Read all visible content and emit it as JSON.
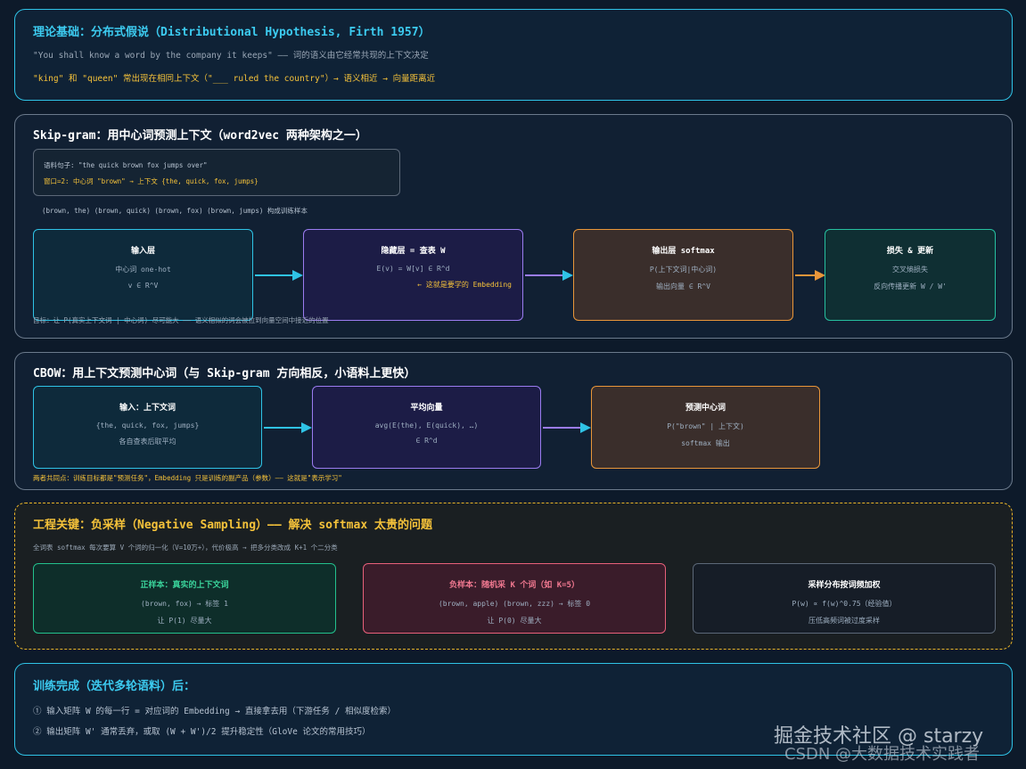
{
  "theory": {
    "title": "理论基础：分布式假说（Distributional Hypothesis, Firth 1957）",
    "quote": "\"You shall know a word by the company it keeps\" —— 词的语义由它经常共现的上下文决定",
    "example": "\"king\" 和 \"queen\" 常出现在相同上下文（\"___ ruled the country\"）→ 语义相近 → 向量距离近"
  },
  "skipgram": {
    "title": "Skip-gram：用中心词预测上下文（word2vec 两种架构之一）",
    "example_sentence": "语料句子: \"the quick brown fox jumps over\"",
    "example_window": "窗口=2: 中心词 \"brown\" → 上下文 {the, quick, fox, jumps}",
    "pairs": "(brown, the) (brown, quick) (brown, fox) (brown, jumps) 构成训练样本",
    "boxes": [
      {
        "title": "输入层",
        "l1": "中心词 one-hot",
        "l2": "v ∈ R^V"
      },
      {
        "title": "隐藏层 = 查表 W",
        "l1": "E(v) = W[v] ∈ R^d",
        "note": "← 这就是要学的 Embedding"
      },
      {
        "title": "输出层 softmax",
        "l1": "P(上下文词|中心词)",
        "l2": "输出向量 ∈ R^V"
      },
      {
        "title": "损失 & 更新",
        "l1": "交叉熵损失",
        "l2": "反向传播更新 W / W'"
      }
    ],
    "footnote": "目标：让 P(真实上下文词 | 中心词) 尽可能大 —— 语义相似的词会被拉到向量空间中接近的位置"
  },
  "cbow": {
    "title": "CBOW：用上下文预测中心词（与 Skip-gram 方向相反，小语料上更快）",
    "boxes": [
      {
        "title": "输入：上下文词",
        "l1": "{the, quick, fox, jumps}",
        "l2": "各自查表后取平均"
      },
      {
        "title": "平均向量",
        "l1": "avg(E(the), E(quick), …)",
        "l2": "∈ R^d"
      },
      {
        "title": "预测中心词",
        "l1": "P(\"brown\" | 上下文)",
        "l2": "softmax 输出"
      }
    ],
    "footnote": "两者共同点：训练目标都是\"预测任务\"，Embedding 只是训练的副产品（参数）—— 这就是\"表示学习\""
  },
  "negsampling": {
    "title": "工程关键：负采样（Negative Sampling）—— 解决 softmax 太贵的问题",
    "desc": "全词表 softmax 每次要算 V 个词的归一化（V=10万+），代价极高 → 把多分类改成 K+1 个二分类",
    "boxes": [
      {
        "title": "正样本：真实的上下文词",
        "l1": "(brown, fox) → 标签 1",
        "l2": "让 P(1) 尽量大"
      },
      {
        "title": "负样本：随机采 K 个词（如 K=5）",
        "l1": "(brown, apple) (brown, zzz) → 标签 0",
        "l2": "让 P(0) 尽量大"
      },
      {
        "title": "采样分布按词频加权",
        "l1": "P(w) ∝ f(w)^0.75（经验值）",
        "l2": "压低高频词被过度采样"
      }
    ]
  },
  "done": {
    "title": "训练完成（迭代多轮语料）后：",
    "l1": "① 输入矩阵 W 的每一行 = 对应词的 Embedding → 直接拿去用（下游任务 / 相似度检索）",
    "l2": "② 输出矩阵 W' 通常丢弃，或取 (W + W')/2 提升稳定性（GloVe 论文的常用技巧）"
  },
  "watermark": {
    "line1": "掘金技术社区 @ starzy",
    "line2": "CSDN @大数据技术实践者"
  }
}
